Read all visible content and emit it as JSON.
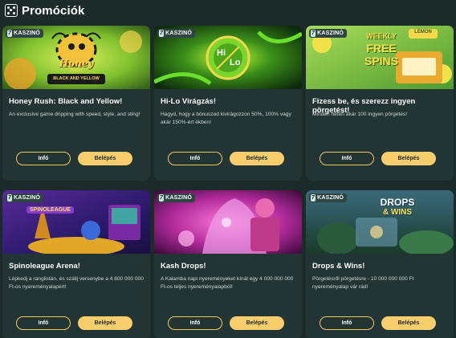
{
  "header": {
    "title": "Promóciók",
    "icon": "dice-icon"
  },
  "badge": {
    "logo_glyph": "7",
    "label": "KASZINÓ"
  },
  "cards": [
    {
      "title": "Honey Rush: Black and Yellow!",
      "description": "An exclusive game dripping with speed, style, and sting!",
      "banner_text": [
        "Honey",
        "Rush",
        "BLACK AND YELLOW"
      ],
      "info_label": "Infó",
      "enter_label": "Belépés"
    },
    {
      "title": "Hi-Lo Virágzás!",
      "description": "Hagyd, hogy a bónuszod kivirágozzon 50%, 100% vagy akár 150%-ért ékben!",
      "banner_text": [
        "Hi",
        "Lo"
      ],
      "info_label": "Infó",
      "enter_label": "Belépés"
    },
    {
      "title": "Fizess be, és szerezz ingyen pörgetést!",
      "description": "Minden héten akár 100 ingyen pörgetés!",
      "banner_text": [
        "WEEKLY",
        "FREE",
        "SPINS",
        "LEMON"
      ],
      "info_label": "Infó",
      "enter_label": "Belépés"
    },
    {
      "title": "Spinoleague Arena!",
      "description": "Lépkedj a ranglistán, és szállj versenybe a 4 800 000 000 Ft-os nyereményalapért!",
      "banner_text": [
        "SPINOLEAGUE"
      ],
      "info_label": "Infó",
      "enter_label": "Belépés"
    },
    {
      "title": "Kash Drops!",
      "description": "A Kalamba napi nyereményeket kínál egy 4 000 000 000 Ft-os teljes nyereményalapból!",
      "banner_text": [],
      "info_label": "Infó",
      "enter_label": "Belépés"
    },
    {
      "title": "Drops & Wins!",
      "description": "Pörgetésről pörgetésre - 10 000 000 000 Ft nyereményalap vár rád!",
      "banner_text": [
        "DROPS",
        "& WINS"
      ],
      "info_label": "Infó",
      "enter_label": "Belépés"
    }
  ],
  "colors": {
    "background": "#1c2a29",
    "card": "#223433",
    "accent": "#f8cd6b",
    "text_muted": "#cfd8d6"
  }
}
